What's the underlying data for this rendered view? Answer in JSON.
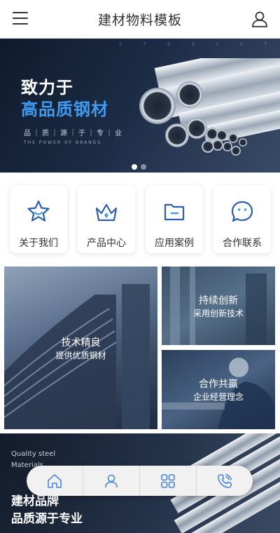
{
  "header": {
    "title": "建材物料模板",
    "menu_icon": "menu-icon",
    "user_icon": "user-icon"
  },
  "banner": {
    "bg_text": "S T E E L   S T E E L   S T E E L",
    "line1": "致力于",
    "line2": "高品质钢材",
    "line3": "品｜质｜源｜于｜专｜业",
    "line4": "THE POWER OF BRANDS",
    "active_slide": 1,
    "slide_count": 2,
    "accent": "#3d9bf2"
  },
  "nav": [
    {
      "label": "关于我们",
      "icon": "star-icon"
    },
    {
      "label": "产品中心",
      "icon": "crown-icon"
    },
    {
      "label": "应用案例",
      "icon": "folder-icon"
    },
    {
      "label": "合作联系",
      "icon": "chat-icon"
    }
  ],
  "tiles": [
    {
      "title": "技术精良",
      "subtitle": "提供优质钢材"
    },
    {
      "title": "持续创新",
      "subtitle": "采用创新技术"
    },
    {
      "title": "合作共赢",
      "subtitle": "企业经营理念"
    }
  ],
  "bottom_banner": {
    "quality_line1": "Quality steel",
    "quality_line2": "Materials",
    "brand_line1": "建材品牌",
    "brand_line2": "品质源于专业"
  },
  "tabbar": [
    {
      "icon": "home-icon"
    },
    {
      "icon": "user-icon"
    },
    {
      "icon": "grid-icon"
    },
    {
      "icon": "phone-icon"
    }
  ],
  "colors": {
    "icon_blue": "#2d5fae",
    "tab_icon": "#4a86d8"
  }
}
